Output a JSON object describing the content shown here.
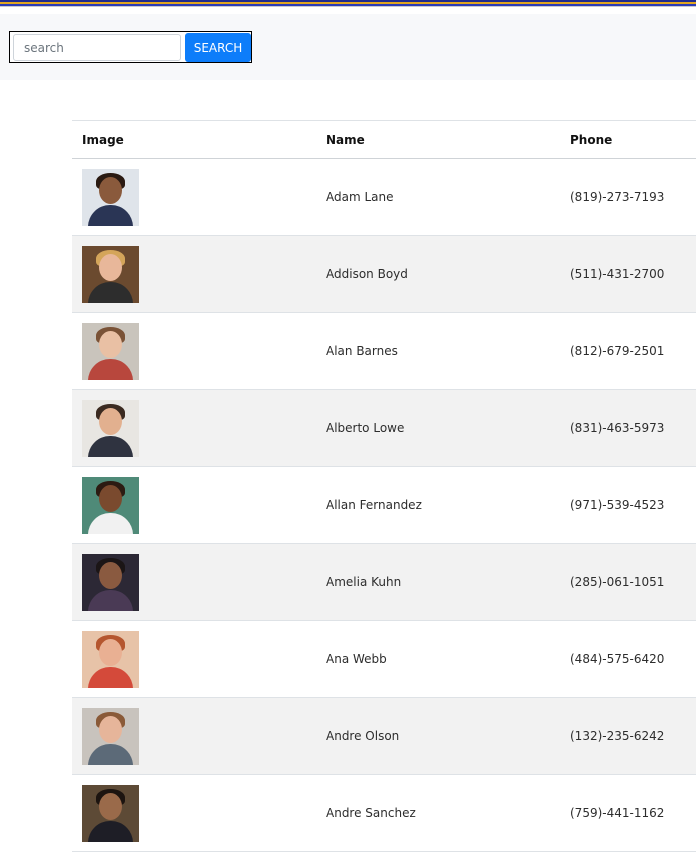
{
  "search": {
    "placeholder": "search",
    "value": "",
    "button_label": "SEARCH"
  },
  "table": {
    "columns": [
      "Image",
      "Name",
      "Phone"
    ],
    "rows": [
      {
        "name": "Adam Lane",
        "phone": "(819)-273-7193",
        "avatar": {
          "bg": "#dfe4ea",
          "skin": "#8a5a3c",
          "hair": "#2a1a12",
          "shirt": "#2a3555"
        }
      },
      {
        "name": "Addison Boyd",
        "phone": "(511)-431-2700",
        "avatar": {
          "bg": "#6b4a2f",
          "skin": "#e8b79a",
          "hair": "#d4a55a",
          "shirt": "#2d2d2d"
        }
      },
      {
        "name": "Alan Barnes",
        "phone": "(812)-679-2501",
        "avatar": {
          "bg": "#c9c4bc",
          "skin": "#e9c0a4",
          "hair": "#7a5236",
          "shirt": "#b8473d"
        }
      },
      {
        "name": "Alberto Lowe",
        "phone": "(831)-463-5973",
        "avatar": {
          "bg": "#e8e6e2",
          "skin": "#e2b08f",
          "hair": "#3b2a20",
          "shirt": "#2f3340"
        }
      },
      {
        "name": "Allan Fernandez",
        "phone": "(971)-539-4523",
        "avatar": {
          "bg": "#4f8a78",
          "skin": "#7a4a2e",
          "hair": "#2c1b12",
          "shirt": "#f1f1f1"
        }
      },
      {
        "name": "Amelia Kuhn",
        "phone": "(285)-061-1051",
        "avatar": {
          "bg": "#2c2835",
          "skin": "#8a5a40",
          "hair": "#1b1516",
          "shirt": "#4a3a55"
        }
      },
      {
        "name": "Ana Webb",
        "phone": "(484)-575-6420",
        "avatar": {
          "bg": "#e7c3a8",
          "skin": "#e9b093",
          "hair": "#b5562f",
          "shirt": "#d44a3a"
        }
      },
      {
        "name": "Andre Olson",
        "phone": "(132)-235-6242",
        "avatar": {
          "bg": "#c8c3bd",
          "skin": "#e6b59a",
          "hair": "#8a5a38",
          "shirt": "#5c6a78"
        }
      },
      {
        "name": "Andre Sanchez",
        "phone": "(759)-441-1162",
        "avatar": {
          "bg": "#5d4a36",
          "skin": "#9a6a4a",
          "hair": "#1c1410",
          "shirt": "#1e1e26"
        }
      }
    ]
  },
  "colors": {
    "accent": "#0d7dfa",
    "row_stripe": "#f2f2f2",
    "toolbar_bg": "#f7f8fa"
  }
}
